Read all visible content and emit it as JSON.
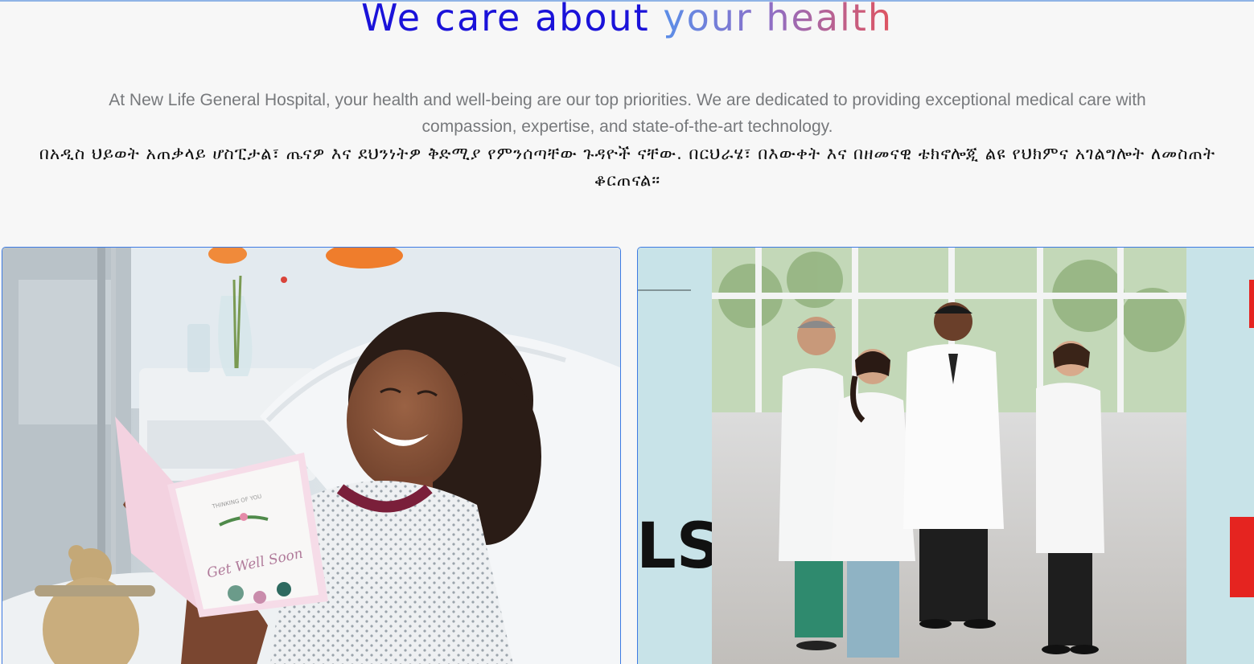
{
  "hero": {
    "title_part1": "We care about",
    "title_part2": "your health",
    "intro_en": "At New Life General Hospital, your health and well-being are our top priorities. We are dedicated to providing exceptional medical care with compassion, expertise, and state-of-the-art technology.",
    "intro_am": "በአዲስ ህይወት አጠቃላይ ሆስፒታል፣ ጤናዎ እና ደህንነትዎ ቅድሚያ የምንሰጣቸው ጉዳዮች ናቸው. በርህራሄ፣ በእውቀት እና በዘመናዊ ቴክኖሎጂ ልዩ የህክምና አገልግሎት ለመስጠት ቆርጠናል።"
  },
  "cards": {
    "left": {
      "card_text_1": "THINKING OF YOU",
      "card_text_2": "Get Well Soon"
    },
    "right": {
      "edge_text": "LS"
    }
  },
  "colors": {
    "title_blue": "#1a12d9",
    "gradient_start": "#5b8ee8",
    "gradient_end": "#e0545f",
    "card_border": "#3d7be3",
    "accent_red": "#e52420"
  }
}
